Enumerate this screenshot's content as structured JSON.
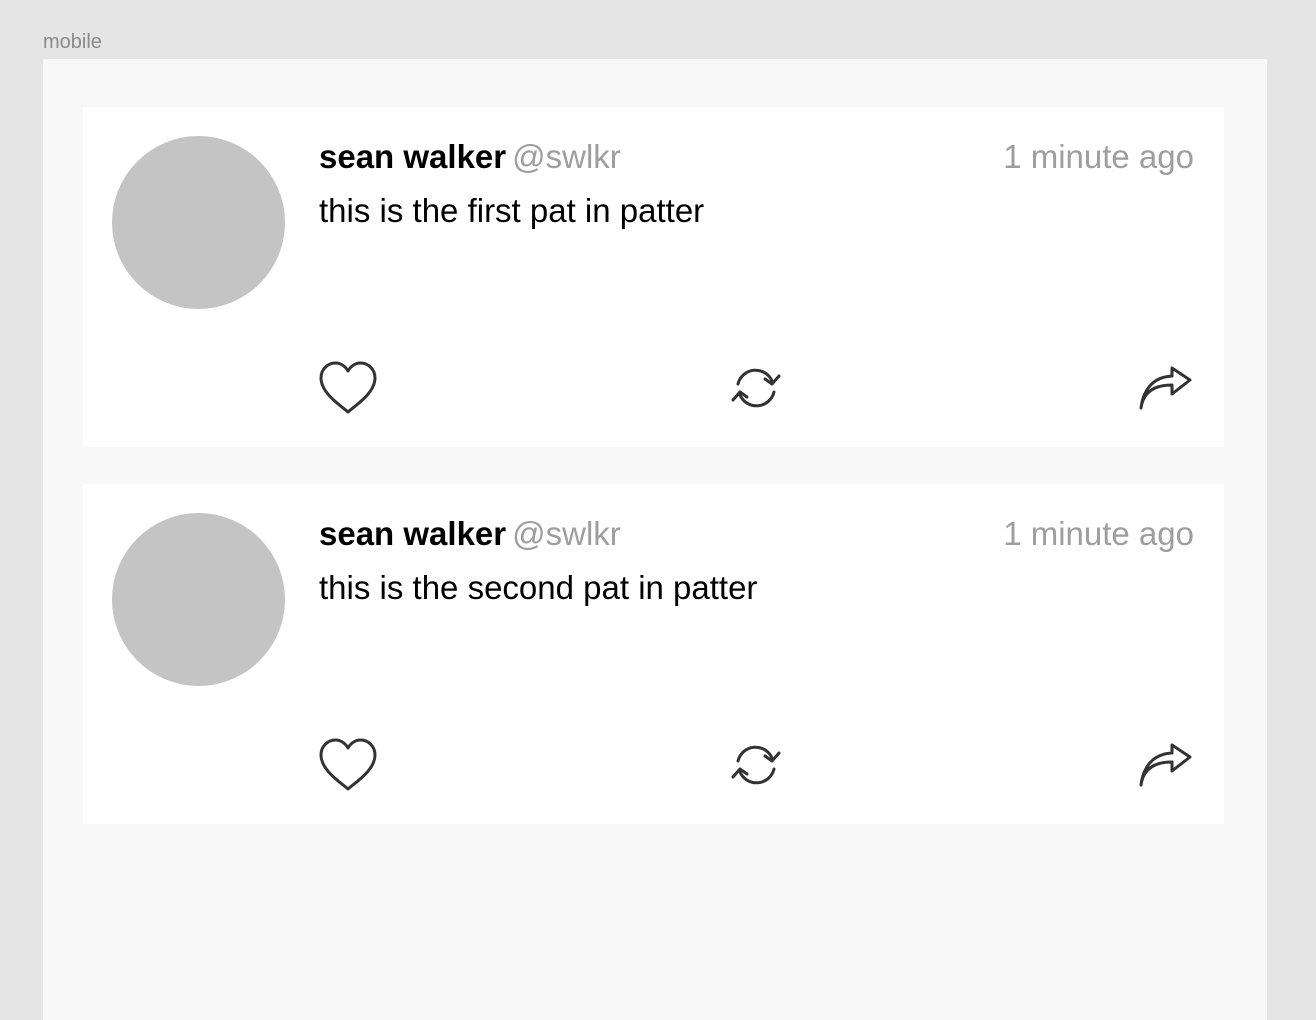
{
  "frame": {
    "label": "mobile"
  },
  "posts": [
    {
      "author_name": "sean walker",
      "author_handle": "@swlkr",
      "time": "1 minute ago",
      "text": "this is the first pat in patter"
    },
    {
      "author_name": "sean walker",
      "author_handle": "@swlkr",
      "time": "1 minute ago",
      "text": "this is the second pat in patter"
    }
  ],
  "icons": {
    "like": "heart-icon",
    "repat": "refresh-icon",
    "share": "share-icon"
  },
  "colors": {
    "background": "#e5e5e5",
    "frame": "#f8f8f8",
    "card": "#ffffff",
    "avatar": "#c4c4c4",
    "muted_text": "#9e9e9e",
    "icon_stroke": "#333333"
  }
}
